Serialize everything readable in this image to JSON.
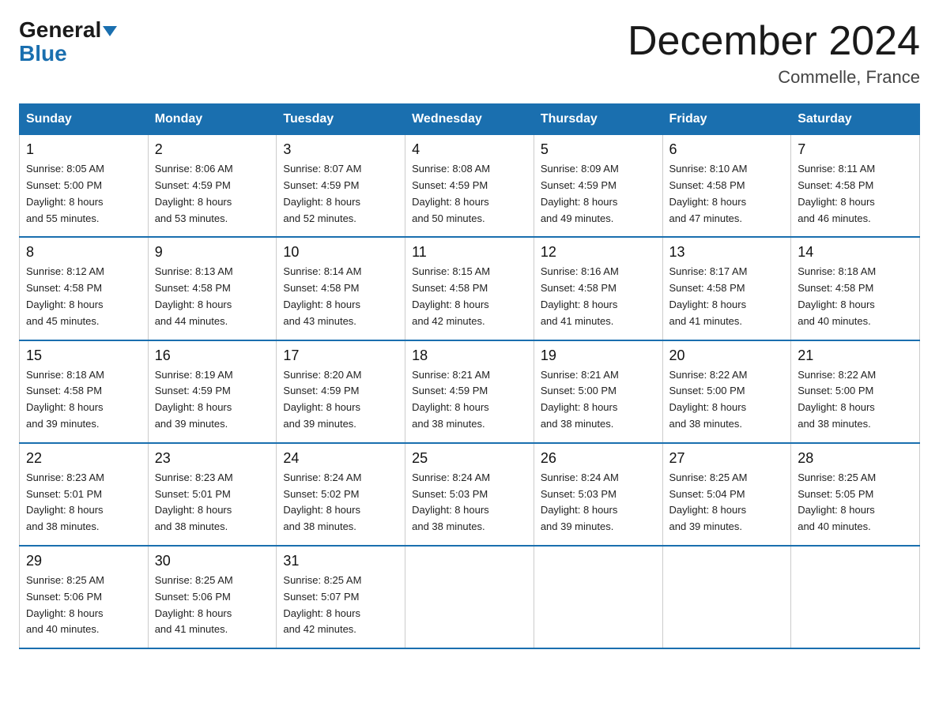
{
  "header": {
    "logo_line1": "General",
    "logo_line2": "Blue",
    "month_title": "December 2024",
    "location": "Commelle, France"
  },
  "days_of_week": [
    "Sunday",
    "Monday",
    "Tuesday",
    "Wednesday",
    "Thursday",
    "Friday",
    "Saturday"
  ],
  "weeks": [
    [
      {
        "day": "1",
        "sunrise": "8:05 AM",
        "sunset": "5:00 PM",
        "daylight": "8 hours and 55 minutes."
      },
      {
        "day": "2",
        "sunrise": "8:06 AM",
        "sunset": "4:59 PM",
        "daylight": "8 hours and 53 minutes."
      },
      {
        "day": "3",
        "sunrise": "8:07 AM",
        "sunset": "4:59 PM",
        "daylight": "8 hours and 52 minutes."
      },
      {
        "day": "4",
        "sunrise": "8:08 AM",
        "sunset": "4:59 PM",
        "daylight": "8 hours and 50 minutes."
      },
      {
        "day": "5",
        "sunrise": "8:09 AM",
        "sunset": "4:59 PM",
        "daylight": "8 hours and 49 minutes."
      },
      {
        "day": "6",
        "sunrise": "8:10 AM",
        "sunset": "4:58 PM",
        "daylight": "8 hours and 47 minutes."
      },
      {
        "day": "7",
        "sunrise": "8:11 AM",
        "sunset": "4:58 PM",
        "daylight": "8 hours and 46 minutes."
      }
    ],
    [
      {
        "day": "8",
        "sunrise": "8:12 AM",
        "sunset": "4:58 PM",
        "daylight": "8 hours and 45 minutes."
      },
      {
        "day": "9",
        "sunrise": "8:13 AM",
        "sunset": "4:58 PM",
        "daylight": "8 hours and 44 minutes."
      },
      {
        "day": "10",
        "sunrise": "8:14 AM",
        "sunset": "4:58 PM",
        "daylight": "8 hours and 43 minutes."
      },
      {
        "day": "11",
        "sunrise": "8:15 AM",
        "sunset": "4:58 PM",
        "daylight": "8 hours and 42 minutes."
      },
      {
        "day": "12",
        "sunrise": "8:16 AM",
        "sunset": "4:58 PM",
        "daylight": "8 hours and 41 minutes."
      },
      {
        "day": "13",
        "sunrise": "8:17 AM",
        "sunset": "4:58 PM",
        "daylight": "8 hours and 41 minutes."
      },
      {
        "day": "14",
        "sunrise": "8:18 AM",
        "sunset": "4:58 PM",
        "daylight": "8 hours and 40 minutes."
      }
    ],
    [
      {
        "day": "15",
        "sunrise": "8:18 AM",
        "sunset": "4:58 PM",
        "daylight": "8 hours and 39 minutes."
      },
      {
        "day": "16",
        "sunrise": "8:19 AM",
        "sunset": "4:59 PM",
        "daylight": "8 hours and 39 minutes."
      },
      {
        "day": "17",
        "sunrise": "8:20 AM",
        "sunset": "4:59 PM",
        "daylight": "8 hours and 39 minutes."
      },
      {
        "day": "18",
        "sunrise": "8:21 AM",
        "sunset": "4:59 PM",
        "daylight": "8 hours and 38 minutes."
      },
      {
        "day": "19",
        "sunrise": "8:21 AM",
        "sunset": "5:00 PM",
        "daylight": "8 hours and 38 minutes."
      },
      {
        "day": "20",
        "sunrise": "8:22 AM",
        "sunset": "5:00 PM",
        "daylight": "8 hours and 38 minutes."
      },
      {
        "day": "21",
        "sunrise": "8:22 AM",
        "sunset": "5:00 PM",
        "daylight": "8 hours and 38 minutes."
      }
    ],
    [
      {
        "day": "22",
        "sunrise": "8:23 AM",
        "sunset": "5:01 PM",
        "daylight": "8 hours and 38 minutes."
      },
      {
        "day": "23",
        "sunrise": "8:23 AM",
        "sunset": "5:01 PM",
        "daylight": "8 hours and 38 minutes."
      },
      {
        "day": "24",
        "sunrise": "8:24 AM",
        "sunset": "5:02 PM",
        "daylight": "8 hours and 38 minutes."
      },
      {
        "day": "25",
        "sunrise": "8:24 AM",
        "sunset": "5:03 PM",
        "daylight": "8 hours and 38 minutes."
      },
      {
        "day": "26",
        "sunrise": "8:24 AM",
        "sunset": "5:03 PM",
        "daylight": "8 hours and 39 minutes."
      },
      {
        "day": "27",
        "sunrise": "8:25 AM",
        "sunset": "5:04 PM",
        "daylight": "8 hours and 39 minutes."
      },
      {
        "day": "28",
        "sunrise": "8:25 AM",
        "sunset": "5:05 PM",
        "daylight": "8 hours and 40 minutes."
      }
    ],
    [
      {
        "day": "29",
        "sunrise": "8:25 AM",
        "sunset": "5:06 PM",
        "daylight": "8 hours and 40 minutes."
      },
      {
        "day": "30",
        "sunrise": "8:25 AM",
        "sunset": "5:06 PM",
        "daylight": "8 hours and 41 minutes."
      },
      {
        "day": "31",
        "sunrise": "8:25 AM",
        "sunset": "5:07 PM",
        "daylight": "8 hours and 42 minutes."
      },
      null,
      null,
      null,
      null
    ]
  ],
  "labels": {
    "sunrise": "Sunrise:",
    "sunset": "Sunset:",
    "daylight": "Daylight:"
  }
}
